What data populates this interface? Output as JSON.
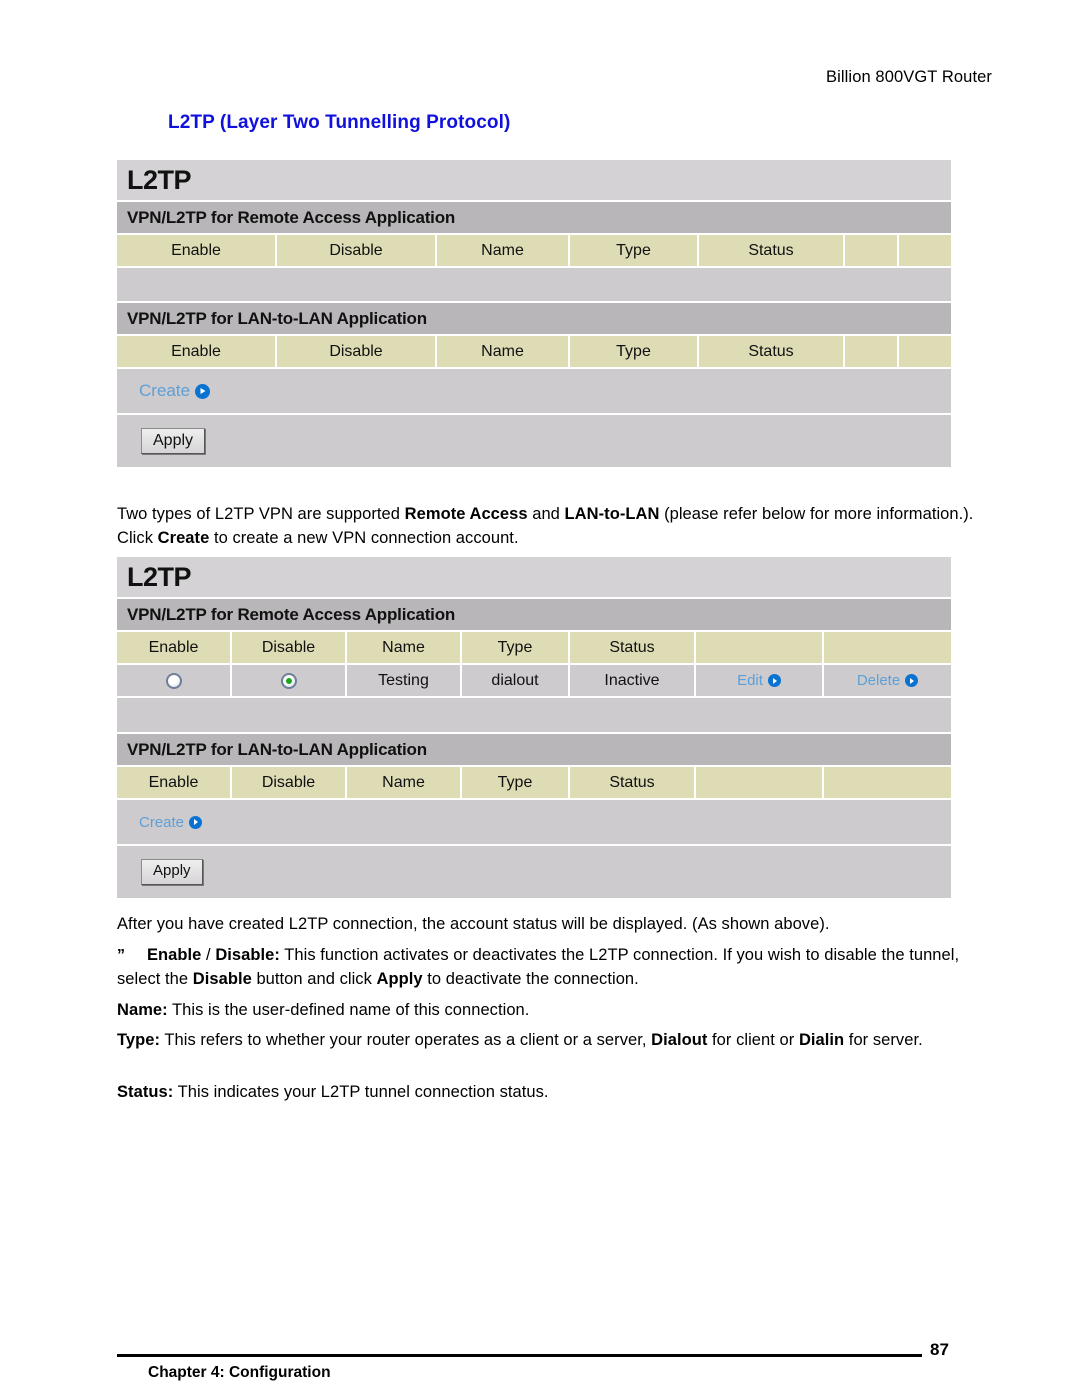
{
  "document": {
    "header_right": "Billion 800VGT Router",
    "section_title": "L2TP (Layer Two Tunnelling Protocol)"
  },
  "panel_one": {
    "title": "L2TP",
    "remote_access": {
      "section_head": "VPN/L2TP for Remote Access Application",
      "columns": [
        "Enable",
        "Disable",
        "Name",
        "Type",
        "Status",
        "",
        ""
      ],
      "rows": []
    },
    "lan_to_lan": {
      "section_head": "VPN/L2TP for LAN-to-LAN Application",
      "columns": [
        "Enable",
        "Disable",
        "Name",
        "Type",
        "Status",
        "",
        ""
      ],
      "rows": []
    },
    "create_label": "Create",
    "apply_label": "Apply"
  },
  "panel_two": {
    "title": "L2TP",
    "remote_access": {
      "section_head": "VPN/L2TP for Remote Access Application",
      "columns": [
        "Enable",
        "Disable",
        "Name",
        "Type",
        "Status",
        "",
        ""
      ],
      "row": {
        "enable_selected": false,
        "disable_selected": true,
        "name": "Testing",
        "type": "dialout",
        "status": "Inactive",
        "edit_label": "Edit",
        "delete_label": "Delete"
      }
    },
    "lan_to_lan": {
      "section_head": "VPN/L2TP for LAN-to-LAN Application",
      "columns": [
        "Enable",
        "Disable",
        "Name",
        "Type",
        "Status",
        "",
        ""
      ]
    },
    "create_label": "Create",
    "apply_label": "Apply"
  },
  "body": {
    "para_intro_a": "Two types of L2TP VPN are supported ",
    "para_intro_b": "Remote Access",
    "para_intro_c": " and ",
    "para_intro_d": "LAN-to-LAN",
    "para_intro_e": " (please refer below for more information.). Click ",
    "para_intro_f": "Create",
    "para_intro_g": " to create a new VPN connection account.",
    "para_after": "After you have created L2TP connection, the account status will be displayed. (As shown above).",
    "bullet_glyph": "”",
    "para_enable_a": "Enable",
    "para_enable_b": " / ",
    "para_enable_c": "Disable:",
    "para_enable_d": " This function activates or deactivates the L2TP connection. If you wish to disable the tunnel, select the ",
    "para_enable_e": "Disable",
    "para_enable_f": " button and click ",
    "para_enable_g": "Apply",
    "para_enable_h": " to deactivate the connection.",
    "para_name_label": "Name:",
    "para_name_text": " This is the user-defined name of this connection.",
    "para_type_label": "Type:",
    "para_type_a": " This refers to whether your router operates as a client or a server, ",
    "para_type_b": "Dialout",
    "para_type_c": " for client or ",
    "para_type_d": "Dialin",
    "para_type_e": " for server.",
    "para_status_label": "Status:",
    "para_status_text": " This indicates your L2TP tunnel connection status."
  },
  "footer": {
    "chapter": "Chapter 4: Configuration",
    "page_number": "87"
  },
  "colors": {
    "link_blue": "#5d9fd6",
    "title_blue": "#1111dd",
    "header_khaki": "#dedcb4",
    "section_gray": "#b8b6b8",
    "panel_gray": "#cdcbcd",
    "title_gray": "#d4d2d4",
    "radio_green": "#1ba81b"
  }
}
